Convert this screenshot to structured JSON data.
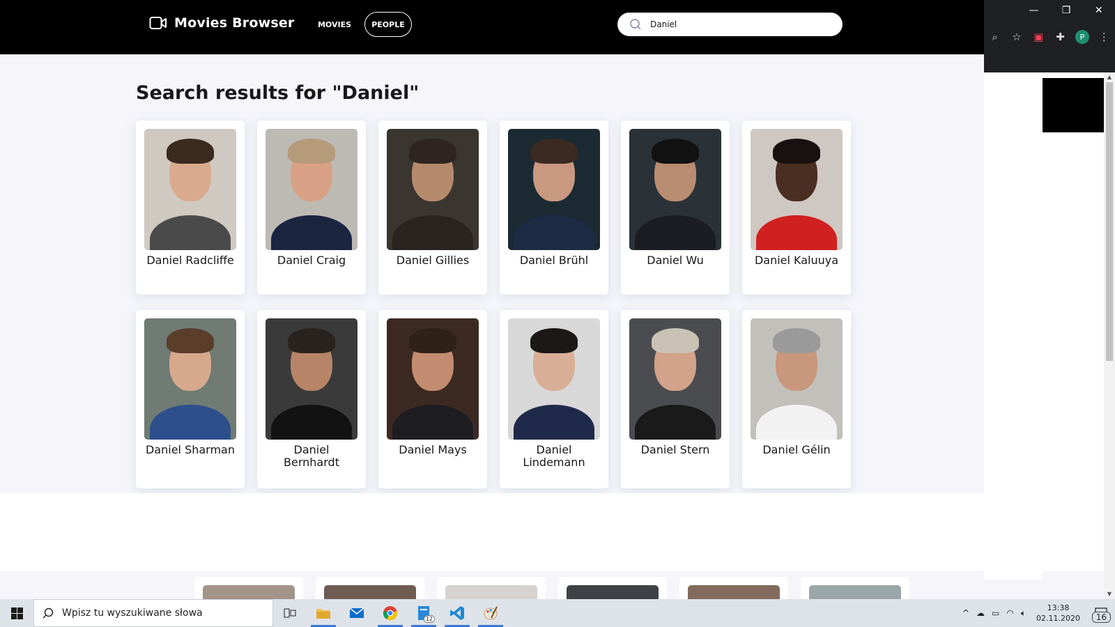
{
  "app": {
    "title": "Movies Browser",
    "nav": {
      "movies": "MOVIES",
      "people": "PEOPLE"
    },
    "search": {
      "value": "Daniel",
      "icon": "search-icon"
    },
    "heading": "Search results for \"Daniel\"",
    "people": [
      {
        "name": "Daniel Radcliffe",
        "skin": "#d9aa8e",
        "hair": "#3b2a1e",
        "bg": "#cfc9c1",
        "shirt": "#4a4a4a"
      },
      {
        "name": "Daniel Craig",
        "skin": "#d8a186",
        "hair": "#b59b7a",
        "bg": "#bdbab3",
        "shirt": "#1b2540"
      },
      {
        "name": "Daniel Gillies",
        "skin": "#b58a6c",
        "hair": "#2e2520",
        "bg": "#3b3530",
        "shirt": "#2a2420"
      },
      {
        "name": "Daniel Brühl",
        "skin": "#c99880",
        "hair": "#3a2a22",
        "bg": "#1b2a33",
        "shirt": "#1e2b44"
      },
      {
        "name": "Daniel Wu",
        "skin": "#b88c70",
        "hair": "#121212",
        "bg": "#2a3238",
        "shirt": "#1a1d22"
      },
      {
        "name": "Daniel Kaluuya",
        "skin": "#4a2e22",
        "hair": "#171210",
        "bg": "#cfc7c2",
        "shirt": "#d0201f"
      },
      {
        "name": "Daniel Sharman",
        "skin": "#d6a98c",
        "hair": "#5a3e2a",
        "bg": "#6f7b73",
        "shirt": "#2d4f8c"
      },
      {
        "name": "Daniel Bernhardt",
        "skin": "#b78468",
        "hair": "#2a221e",
        "bg": "#3a3a3a",
        "shirt": "#121212"
      },
      {
        "name": "Daniel Mays",
        "skin": "#c38c70",
        "hair": "#2e2118",
        "bg": "#3c2a22",
        "shirt": "#1d1d22"
      },
      {
        "name": "Daniel Lindemann",
        "skin": "#d9ae96",
        "hair": "#1c1818",
        "bg": "#d8d8d8",
        "shirt": "#1f2a4a"
      },
      {
        "name": "Daniel Stern",
        "skin": "#d2a28a",
        "hair": "#c9c2b4",
        "bg": "#4b4c50",
        "shirt": "#1a1a1a"
      },
      {
        "name": "Daniel Gélin",
        "skin": "#c8977c",
        "hair": "#9a9a9a",
        "bg": "#c2c0bb",
        "shirt": "#f2f2f2"
      }
    ]
  },
  "peek_images": [
    {
      "bg": "#a3948a"
    },
    {
      "bg": "#6e5c53"
    },
    {
      "bg": "#d7d2cf"
    },
    {
      "bg": "#3f4147"
    },
    {
      "bg": "#826b5d"
    },
    {
      "bg": "#9aa6a8"
    }
  ],
  "taskbar": {
    "search_placeholder": "Wpisz tu wyszukiwane słowa",
    "badge": "12",
    "time": "13:38",
    "date": "02.11.2020",
    "notifications": "16"
  },
  "chrome": {
    "profile_initial": "P"
  }
}
